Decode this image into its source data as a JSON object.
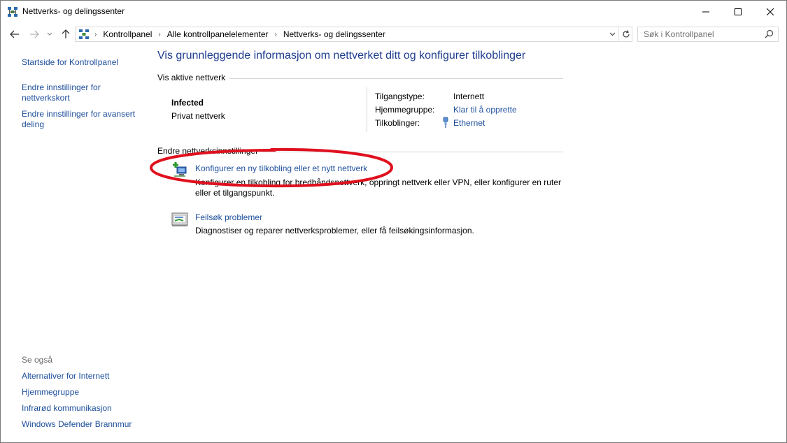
{
  "window": {
    "title": "Nettverks- og delingssenter",
    "icon": "network-center-icon"
  },
  "nav": {
    "breadcrumbs": [
      "Kontrollpanel",
      "Alle kontrollpanelelementer",
      "Nettverks- og delingssenter"
    ],
    "search_placeholder": "Søk i Kontrollpanel"
  },
  "sidebar": {
    "home_link": "Startside for Kontrollpanel",
    "links": [
      "Endre innstillinger for nettverkskort",
      "Endre innstillinger for avansert deling"
    ],
    "see_also_heading": "Se også",
    "see_also": [
      "Alternativer for Internett",
      "Hjemmegruppe",
      "Infrarød kommunikasjon",
      "Windows Defender Brannmur"
    ]
  },
  "main": {
    "title": "Vis grunnleggende informasjon om nettverket ditt og konfigurer tilkoblinger",
    "active_networks_label": "Vis aktive nettverk",
    "network": {
      "name": "Infected",
      "type": "Privat nettverk",
      "access_type_label": "Tilgangstype:",
      "access_type_value": "Internett",
      "homegroup_label": "Hjemmegruppe:",
      "homegroup_value": "Klar til å opprette",
      "connections_label": "Tilkoblinger:",
      "connections_value": "Ethernet"
    },
    "change_settings_label": "Endre nettverksinnstillinger",
    "tasks": [
      {
        "link": "Konfigurer en ny tilkobling eller et nytt nettverk",
        "description": "Konfigurer en tilkobling for bredbåndsnettverk, oppringt nettverk eller VPN, eller konfigurer en ruter eller et tilgangspunkt.",
        "icon": "new-connection-icon"
      },
      {
        "link": "Feilsøk problemer",
        "description": "Diagnostiser og reparer nettverksproblemer, eller få feilsøkingsinformasjon.",
        "icon": "troubleshoot-icon"
      }
    ]
  },
  "colors": {
    "link": "#1e4f9b",
    "title": "#1e3d8f",
    "annotation": "#e0101e"
  }
}
